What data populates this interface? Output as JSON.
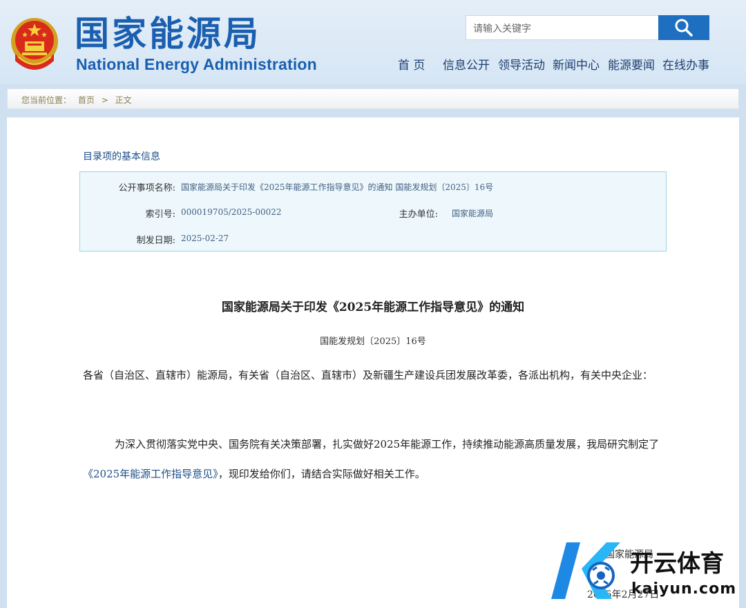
{
  "header": {
    "logo_cn": "国家能源局",
    "logo_en": "National Energy Administration",
    "search_placeholder": "请输入关键字",
    "nav": [
      "首 页",
      "信息公开",
      "领导活动",
      "新闻中心",
      "能源要闻",
      "在线办事"
    ]
  },
  "breadcrumb": {
    "prefix": "您当前位置：",
    "home": "首页",
    "separator": ">",
    "current": "正文"
  },
  "info": {
    "section_title": "目录项的基本信息",
    "item_label": "公开事项名称:",
    "item_value": "国家能源局关于印发《2025年能源工作指导意见》的通知 国能发规划〔2025〕16号",
    "index_label": "索引号:",
    "index_value": "000019705/2025-00022",
    "org_label": "主办单位:",
    "org_value": "国家能源局",
    "date_label": "制发日期:",
    "date_value": "2025-02-27"
  },
  "doc": {
    "title": "国家能源局关于印发《2025年能源工作指导意见》的通知",
    "number": "国能发规划〔2025〕16号",
    "para1": "各省（自治区、直辖市）能源局，有关省（自治区、直辖市）及新疆生产建设兵团发展改革委，各派出机构，有关中央企业：",
    "para2_pre": "为深入贯彻落实党中央、国务院有关决策部署，扎实做好2025年能源工作，持续推动能源高质量发展，我局研究制定了",
    "para2_link": "《2025年能源工作指导意见》",
    "para2_post": "，现印发给你们，请结合实际做好相关工作。",
    "signer": "国家能源局",
    "sign_date": "2025年2月27日"
  },
  "watermark": {
    "cn": "开云体育",
    "en": "kaiyun.com"
  },
  "colors": {
    "brand_blue": "#1a5fb0",
    "link_blue": "#1b4e89",
    "search_btn": "#1f6fc0"
  }
}
